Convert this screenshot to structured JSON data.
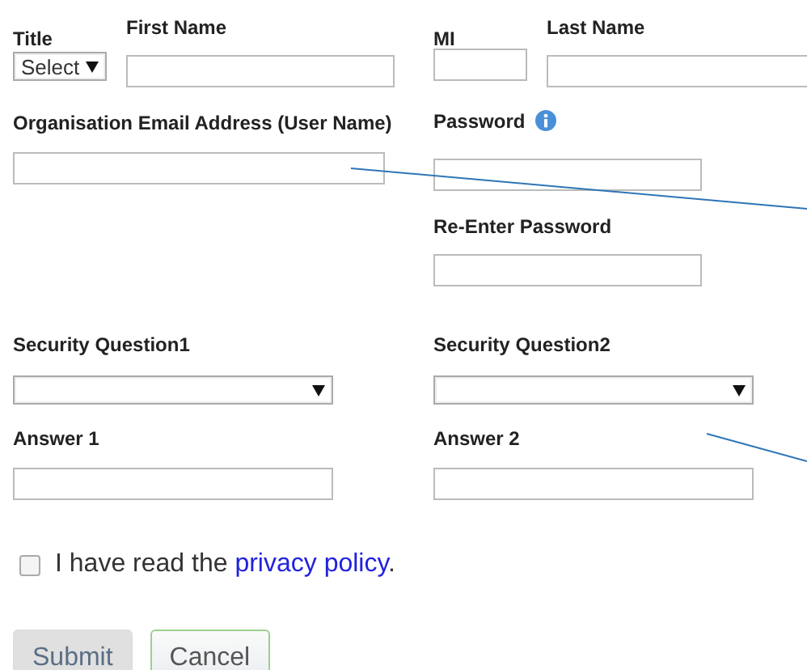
{
  "fields": [
    {
      "label": "Title",
      "kind": "select",
      "value": "Select"
    },
    {
      "label": "First Name",
      "kind": "text"
    },
    {
      "label": "MI",
      "kind": "text"
    },
    {
      "label": "Last Name",
      "kind": "text"
    },
    {
      "label": "Organisation Email Address (User Name)",
      "kind": "text"
    },
    {
      "label": "Password",
      "kind": "password",
      "info": true
    },
    {
      "label": "Re-Enter Password",
      "kind": "password"
    },
    {
      "label": "Security Question1",
      "kind": "select"
    },
    {
      "label": "Security Question2",
      "kind": "select"
    },
    {
      "label": "Answer 1",
      "kind": "text"
    },
    {
      "label": "Answer 2",
      "kind": "text"
    }
  ],
  "agreement": {
    "text": "I have read the",
    "link": "privacy policy",
    "after": ".",
    "checked": false
  },
  "buttons": [
    {
      "label": "Submit",
      "kind": "primary"
    },
    {
      "label": "Cancel",
      "kind": "secondary"
    }
  ]
}
